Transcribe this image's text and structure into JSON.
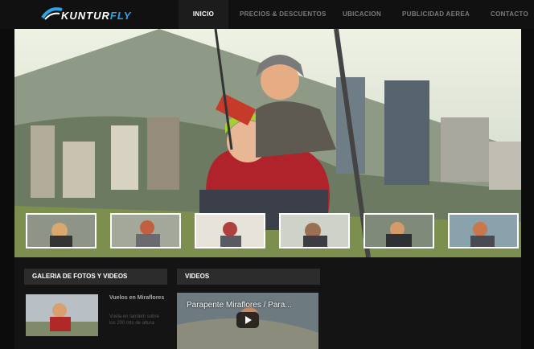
{
  "brand": {
    "logo_part1": "KUNTUR",
    "logo_part2": "FLY"
  },
  "nav": {
    "items": [
      {
        "label": "INICIO",
        "active": true
      },
      {
        "label": "PRECIOS & DESCUENTOS",
        "active": false
      },
      {
        "label": "UBICACION",
        "active": false
      },
      {
        "label": "PUBLICIDAD AEREA",
        "active": false
      },
      {
        "label": "CONTACTO",
        "active": false
      }
    ]
  },
  "gallery": {
    "title": "GALERIA DE FOTOS Y VIDEOS",
    "item_heading": "Vuelos en Miraflores",
    "item_desc": "Vuela en tandem sobre los 200 mts de altura"
  },
  "videos": {
    "title": "VIDEOS",
    "video_title": "Parapente Miraflores / Para..."
  },
  "icons": {
    "play": "play-icon",
    "logo": "paraglider-logo-icon"
  },
  "colors": {
    "accent": "#27a7e8",
    "header_bg": "#111111",
    "panel_title_bg": "#2c2c2c"
  }
}
